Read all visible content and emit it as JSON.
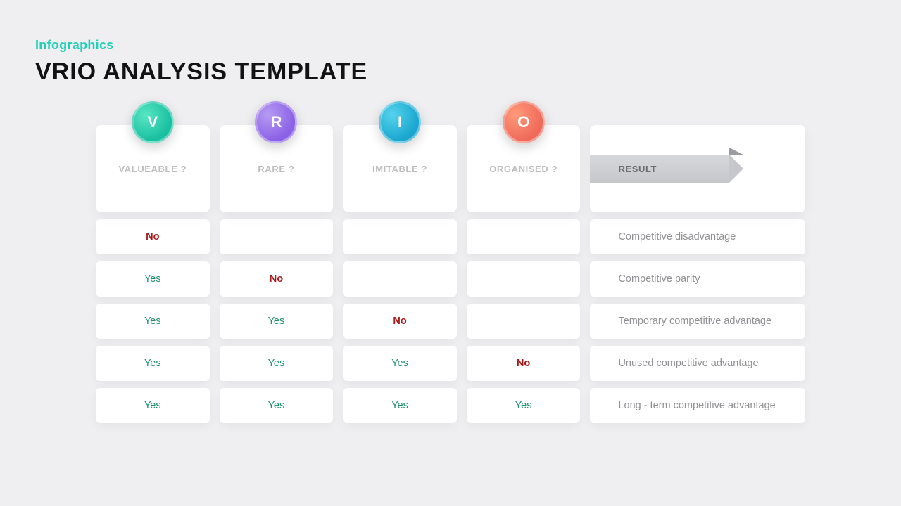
{
  "kicker": "Infographics",
  "title": "VRIO ANALYSIS TEMPLATE",
  "columns": [
    {
      "letter": "V",
      "badgeClass": "v",
      "label": "VALUEABLE ?"
    },
    {
      "letter": "R",
      "badgeClass": "r",
      "label": "RARE ?"
    },
    {
      "letter": "I",
      "badgeClass": "i",
      "label": "IMITABLE ?"
    },
    {
      "letter": "O",
      "badgeClass": "o",
      "label": "ORGANISED ?"
    }
  ],
  "result_label": "RESULT",
  "rows": [
    {
      "v": "No",
      "r": "",
      "i": "",
      "o": "",
      "result": "Competitive disadvantage"
    },
    {
      "v": "Yes",
      "r": "No",
      "i": "",
      "o": "",
      "result": "Competitive parity"
    },
    {
      "v": "Yes",
      "r": "Yes",
      "i": "No",
      "o": "",
      "result": "Temporary competitive advantage"
    },
    {
      "v": "Yes",
      "r": "Yes",
      "i": "Yes",
      "o": "No",
      "result": "Unused competitive advantage"
    },
    {
      "v": "Yes",
      "r": "Yes",
      "i": "Yes",
      "o": "Yes",
      "result": "Long - term competitive advantage"
    }
  ]
}
